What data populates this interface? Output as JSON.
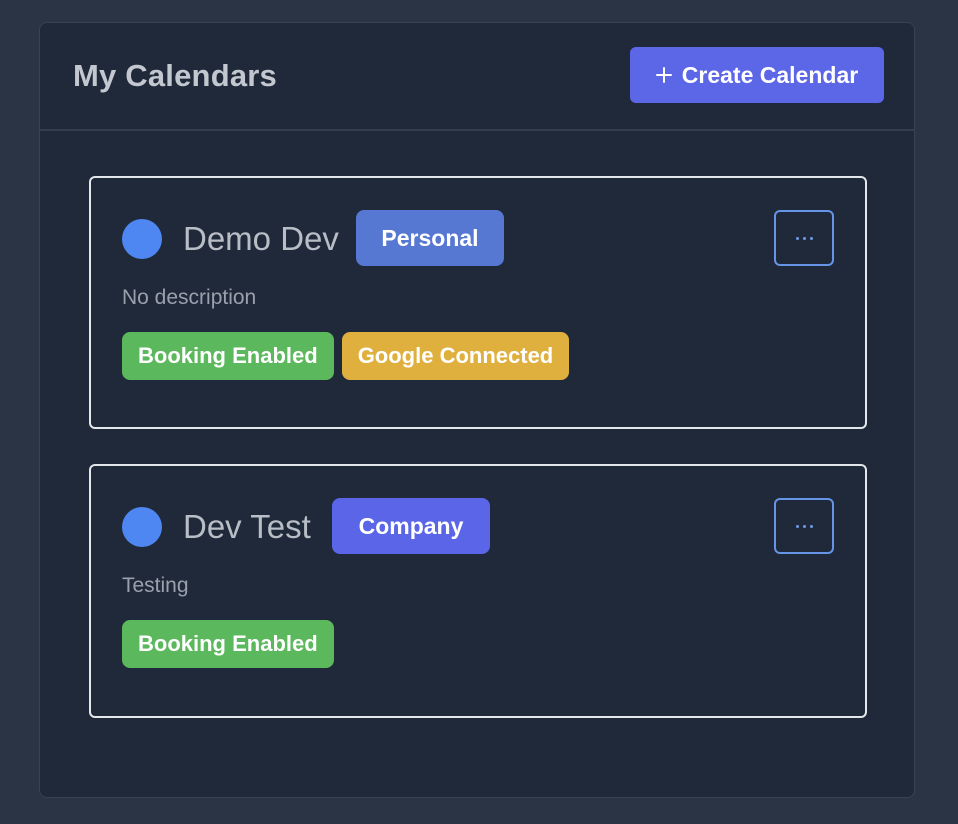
{
  "header": {
    "title": "My Calendars",
    "create_label": "Create Calendar"
  },
  "calendars": [
    {
      "name": "Demo Dev",
      "type": "Personal",
      "description": "No description",
      "dot_color": "#4e86f2",
      "tags": [
        "Booking Enabled",
        "Google Connected"
      ]
    },
    {
      "name": "Dev Test",
      "type": "Company",
      "description": "Testing",
      "dot_color": "#4e86f2",
      "tags": [
        "Booking Enabled"
      ]
    }
  ],
  "icons": {
    "create": "plus-icon",
    "more": "more-horizontal-icon"
  },
  "colors": {
    "primary": "#5b67e7",
    "personal_badge": "#5677d2",
    "booking_tag": "#5cb85c",
    "google_tag": "#e0b03f"
  }
}
